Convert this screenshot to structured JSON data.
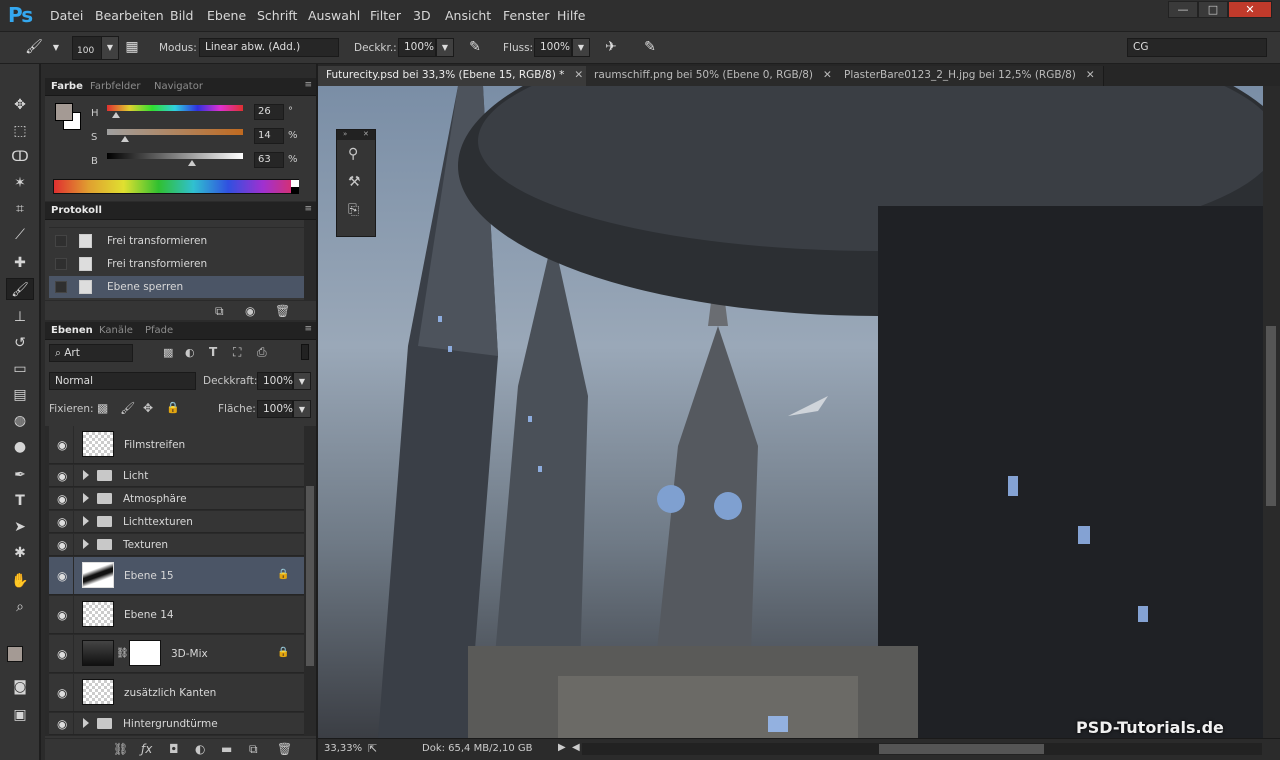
{
  "app": {
    "logo": "Ps"
  },
  "menu": [
    "Datei",
    "Bearbeiten",
    "Bild",
    "Ebene",
    "Schrift",
    "Auswahl",
    "Filter",
    "3D",
    "Ansicht",
    "Fenster",
    "Hilfe"
  ],
  "window_controls": {
    "minimize": "—",
    "restore": "□",
    "close": "✕"
  },
  "options_bar": {
    "brush_size": "100",
    "mode_label": "Modus:",
    "mode_value": "Linear abw. (Add.)",
    "opacity_label": "Deckkr.:",
    "opacity_value": "100%",
    "flow_label": "Fluss:",
    "flow_value": "100%",
    "workspace": "CG"
  },
  "color_panel": {
    "tabs": [
      "Farbe",
      "Farbfelder",
      "Navigator"
    ],
    "h_label": "H",
    "h_value": "26",
    "h_unit": "°",
    "s_label": "S",
    "s_value": "14",
    "s_unit": "%",
    "b_label": "B",
    "b_value": "63",
    "b_unit": "%"
  },
  "history_panel": {
    "tab": "Protokoll",
    "items": [
      "Frei transformieren",
      "Frei transformieren",
      "Ebene sperren"
    ]
  },
  "layers_panel": {
    "tabs": [
      "Ebenen",
      "Kanäle",
      "Pfade"
    ],
    "filter_kind": "Art",
    "blend_mode": "Normal",
    "opacity_label": "Deckkraft:",
    "opacity_value": "100%",
    "lock_label": "Fixieren:",
    "fill_label": "Fläche:",
    "fill_value": "100%",
    "layers": [
      {
        "name": "Filmstreifen"
      },
      {
        "name": "Licht"
      },
      {
        "name": "Atmosphäre"
      },
      {
        "name": "Lichttexturen"
      },
      {
        "name": "Texturen"
      },
      {
        "name": "Ebene 15"
      },
      {
        "name": "Ebene 14"
      },
      {
        "name": "3D-Mix"
      },
      {
        "name": "zusätzlich Kanten"
      },
      {
        "name": "Hintergrundtürme"
      }
    ]
  },
  "documents": [
    {
      "title": "Futurecity.psd bei 33,3% (Ebene 15, RGB/8) *"
    },
    {
      "title": "raumschiff.png bei 50% (Ebene 0, RGB/8)"
    },
    {
      "title": "PlasterBare0123_2_H.jpg bei 12,5% (RGB/8)"
    }
  ],
  "status": {
    "zoom": "33,33%",
    "doc": "Dok: 65,4 MB/2,10 GB"
  },
  "watermark": "PSD-Tutorials.de"
}
